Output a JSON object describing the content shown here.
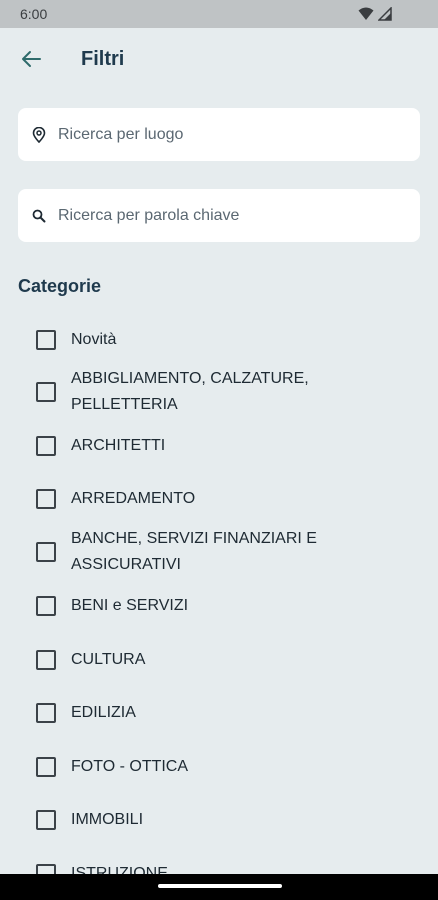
{
  "status_bar": {
    "time": "6:00"
  },
  "app_bar": {
    "back_icon": "arrow-left-icon",
    "title": "Filtri"
  },
  "location_search": {
    "icon": "location-pin-icon",
    "placeholder": "Ricerca per luogo",
    "value": ""
  },
  "keyword_search": {
    "icon": "search-icon",
    "placeholder": "Ricerca per parola chiave",
    "value": ""
  },
  "categories": {
    "title": "Categorie",
    "items": [
      {
        "label": "Novità",
        "checked": false
      },
      {
        "label": "ABBIGLIAMENTO, CALZATURE, PELLETTERIA",
        "checked": false
      },
      {
        "label": "ARCHITETTI",
        "checked": false
      },
      {
        "label": "ARREDAMENTO",
        "checked": false
      },
      {
        "label": "BANCHE, SERVIZI FINANZIARI E ASSICURATIVI",
        "checked": false
      },
      {
        "label": "BENI e SERVIZI",
        "checked": false
      },
      {
        "label": "CULTURA",
        "checked": false
      },
      {
        "label": "EDILIZIA",
        "checked": false
      },
      {
        "label": "FOTO - OTTICA",
        "checked": false
      },
      {
        "label": "IMMOBILI",
        "checked": false
      },
      {
        "label": "ISTRUZIONE",
        "checked": false
      }
    ]
  },
  "colors": {
    "background": "#e6ecee",
    "accent": "#1f3a4d",
    "back_arrow": "#2f6b6b"
  }
}
